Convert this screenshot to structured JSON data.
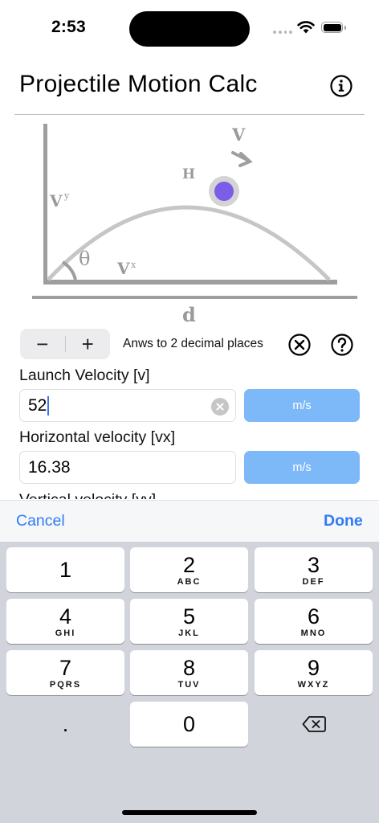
{
  "status": {
    "time": "2:53"
  },
  "header": {
    "title": "Projectile Motion Calc"
  },
  "diagram": {
    "labels": {
      "velocity": "V",
      "height": "H",
      "vy": "V",
      "vy_sub": "y",
      "theta": "θ",
      "vx": "V",
      "vx_sub": "x",
      "distance": "d"
    },
    "colors": {
      "axes": "#9e9e9e",
      "arc": "#c6c6c6",
      "ball": "#7a5ee8",
      "halo": "#d4d4d4",
      "text": "#9a9a9a"
    }
  },
  "controls": {
    "decrement": "−",
    "increment": "+",
    "precision_text": "Anws to 2 decimal places"
  },
  "fields": [
    {
      "label": "Launch Velocity [v]",
      "value": "52",
      "unit": "m/s"
    },
    {
      "label": "Horizontal velocity [vx]",
      "value": "16.38",
      "unit": "m/s"
    },
    {
      "label": "Vertical velocity [vy]"
    }
  ],
  "keyboard": {
    "cancel": "Cancel",
    "done": "Done",
    "keys": [
      {
        "num": "1",
        "letters": ""
      },
      {
        "num": "2",
        "letters": "ABC"
      },
      {
        "num": "3",
        "letters": "DEF"
      },
      {
        "num": "4",
        "letters": "GHI"
      },
      {
        "num": "5",
        "letters": "JKL"
      },
      {
        "num": "6",
        "letters": "MNO"
      },
      {
        "num": "7",
        "letters": "PQRS"
      },
      {
        "num": "8",
        "letters": "TUV"
      },
      {
        "num": "9",
        "letters": "WXYZ"
      },
      {
        "num": ".",
        "letters": ""
      },
      {
        "num": "0",
        "letters": ""
      }
    ]
  },
  "accent_colors": {
    "link": "#2f7bf6",
    "unit_button": "#7db9f8",
    "caret": "#3d6ff0"
  }
}
